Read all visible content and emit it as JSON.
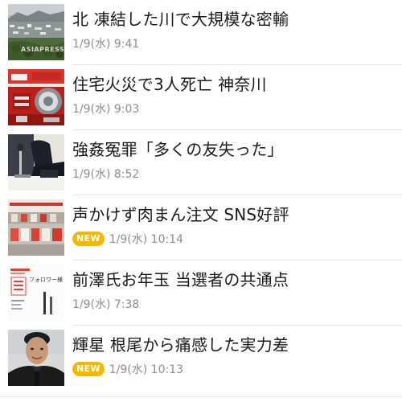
{
  "articles": [
    {
      "title": "北 凍結した川で大規模な密輸",
      "time": "1/9(水) 9:41",
      "badge": "",
      "thumbnail": "aerial-town-photo",
      "watermark": "ASIAPRESS"
    },
    {
      "title": "住宅火災で3人死亡 神奈川",
      "time": "1/9(水) 9:03",
      "badge": "",
      "thumbnail": "fire-truck-photo"
    },
    {
      "title": "強姦冤罪「多くの友失った」",
      "time": "1/9(水) 8:52",
      "badge": "",
      "thumbnail": "press-conference-photo"
    },
    {
      "title": "声かけず肉まん注文 SNS好評",
      "time": "1/9(水) 10:14",
      "badge": "NEW",
      "thumbnail": "convenience-store-photo"
    },
    {
      "title": "前澤氏お年玉 当選者の共通点",
      "time": "1/9(水) 7:38",
      "badge": "",
      "thumbnail": "new-year-card-photo",
      "card_text": "フォロワー様"
    },
    {
      "title": "輝星 根尾から痛感した実力差",
      "time": "1/9(水) 10:13",
      "badge": "NEW",
      "thumbnail": "baseball-player-portrait"
    }
  ],
  "colors": {
    "badge_bg": "#f5b800",
    "title": "#1a1a1a",
    "meta": "#8c8c8c",
    "divider": "#e3e3e3"
  }
}
